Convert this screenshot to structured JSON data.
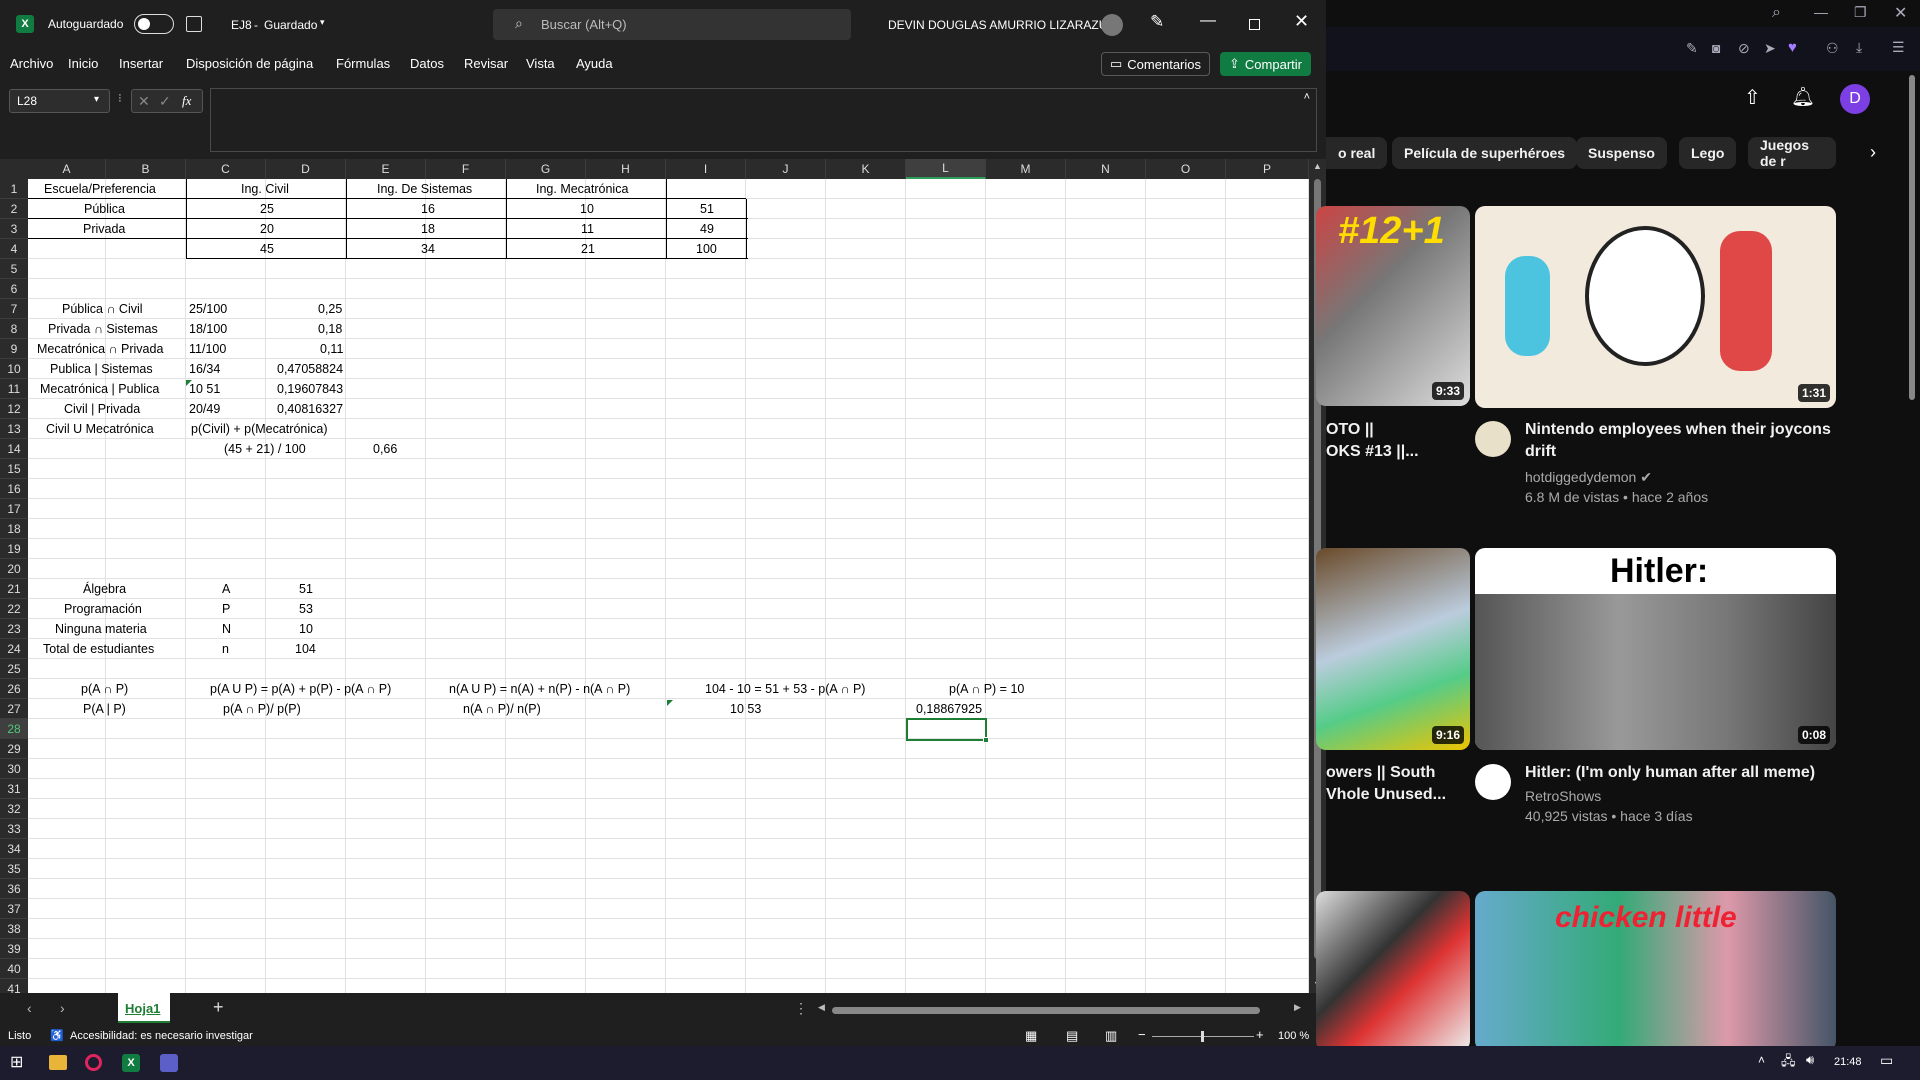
{
  "excel": {
    "autosave_label": "Autoguardado",
    "file_name": "EJ8",
    "file_status": "Guardado",
    "search_placeholder": "Buscar (Alt+Q)",
    "user_name": "DEVIN DOUGLAS AMURRIO LIZARAZU",
    "menus": [
      "Archivo",
      "Inicio",
      "Insertar",
      "Disposición de página",
      "Fórmulas",
      "Datos",
      "Revisar",
      "Vista",
      "Ayuda"
    ],
    "comments_label": "Comentarios",
    "share_label": "Compartir",
    "name_box": "L28",
    "fx_label": "fx",
    "columns": [
      "A",
      "B",
      "C",
      "D",
      "E",
      "F",
      "G",
      "H",
      "I",
      "J",
      "K",
      "L",
      "M",
      "N",
      "O",
      "P"
    ],
    "rows": [
      "1",
      "2",
      "3",
      "4",
      "5",
      "6",
      "7",
      "8",
      "9",
      "10",
      "11",
      "12",
      "13",
      "14",
      "15",
      "16",
      "17",
      "18",
      "19",
      "20",
      "21",
      "22",
      "23",
      "24",
      "25",
      "26",
      "27",
      "28",
      "29",
      "30",
      "31",
      "32",
      "33",
      "34",
      "35",
      "36",
      "37",
      "38",
      "39",
      "40",
      "41"
    ],
    "cells": {
      "r1": [
        "Escuela/Preferencia",
        "Ing. Civil",
        "Ing. De Sistemas",
        "Ing. Mecatrónica"
      ],
      "r2": [
        "Pública",
        "25",
        "16",
        "10",
        "51"
      ],
      "r3": [
        "Privada",
        "20",
        "18",
        "11",
        "49"
      ],
      "r4": [
        "45",
        "34",
        "21",
        "100"
      ],
      "r7": [
        "Pública ∩ Civil",
        "25/100",
        "0,25"
      ],
      "r8": [
        "Privada ∩ Sistemas",
        "18/100",
        "0,18"
      ],
      "r9": [
        "Mecatrónica ∩ Privada",
        "11/100",
        "0,11"
      ],
      "r10": [
        "Publica | Sistemas",
        "16/34",
        "0,47058824"
      ],
      "r11": [
        "Mecatrónica | Publica",
        "10 51",
        "0,19607843"
      ],
      "r12": [
        "Civil | Privada",
        "20/49",
        "0,40816327"
      ],
      "r13": [
        "Civil U Mecatrónica",
        "p(Civil) + p(Mecatrónica)"
      ],
      "r14": [
        "(45 + 21) / 100",
        "0,66"
      ],
      "r21": [
        "Álgebra",
        "A",
        "51"
      ],
      "r22": [
        "Programación",
        "P",
        "53"
      ],
      "r23": [
        "Ninguna materia",
        "N",
        "10"
      ],
      "r24": [
        "Total de estudiantes",
        "n",
        "104"
      ],
      "r26": [
        "p(A ∩ P)",
        "p(A U P) = p(A) + p(P) - p(A ∩ P)",
        "n(A U P) = n(A) + n(P) - n(A ∩ P)",
        "104 - 10 = 51 + 53 - p(A ∩ P)",
        "p(A ∩ P) = 10"
      ],
      "r27": [
        "P(A | P)",
        "p(A ∩ P)/ p(P)",
        "n(A ∩ P)/ n(P)",
        "10 53",
        "0,18867925"
      ]
    },
    "sheet_tab": "Hoja1",
    "status_ready": "Listo",
    "accessibility": "Accesibilidad: es necesario investigar",
    "zoom": "100 %"
  },
  "youtube": {
    "avatar_letter": "D",
    "chips": [
      "o real",
      "Película de superhéroes",
      "Suspenso",
      "Lego",
      "Juegos de r"
    ],
    "videos": [
      {
        "title_line1": "OTO ||",
        "title_line2": "OKS #13 ||...",
        "duration": "9:33",
        "thumb_text": "#12+1"
      },
      {
        "title_line1": "Nintendo employees when their joycons",
        "title_line2": "drift",
        "channel": "hotdiggedydemon",
        "meta": "6.8 M de vistas • hace 2 años",
        "duration": "1:31"
      },
      {
        "title_line1": "owers || South",
        "title_line2": "Vhole Unused...",
        "duration": "9:16"
      },
      {
        "title_line1": "Hitler: (I'm only human after all meme)",
        "channel": "RetroShows",
        "meta": "40,925 vistas • hace 3 días",
        "duration": "0:08",
        "thumb_text": "Hitler:"
      },
      {
        "thumb_text": "chicken little"
      }
    ]
  },
  "taskbar": {
    "time": "21:48"
  },
  "colors": {
    "excel_green": "#107c41",
    "youtube_bg": "#0f0f0f",
    "taskbar": "#1c1c2e"
  }
}
